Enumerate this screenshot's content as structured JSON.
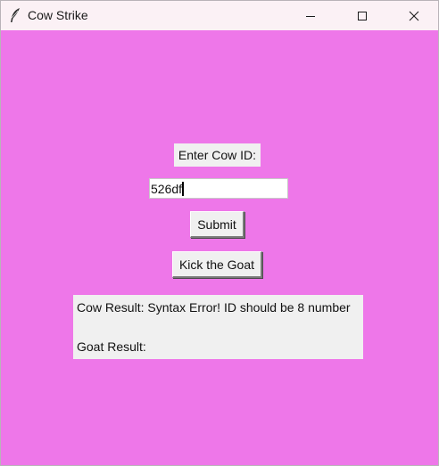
{
  "window": {
    "title": "Cow Strike",
    "app_icon": "feather-icon",
    "controls": [
      "minimize-icon",
      "maximize-icon",
      "close-icon"
    ]
  },
  "colors": {
    "client_background": "#ee77e9",
    "titlebar_background": "#fbf1f5",
    "widget_background": "#f0f0f0"
  },
  "form": {
    "cow_id_label": "Enter Cow ID:",
    "cow_id_value": "526df",
    "submit_label": "Submit",
    "kick_label": "Kick the Goat"
  },
  "results": {
    "cow": "Cow Result: Syntax Error! ID should be 8 number",
    "goat": "Goat Result:"
  }
}
